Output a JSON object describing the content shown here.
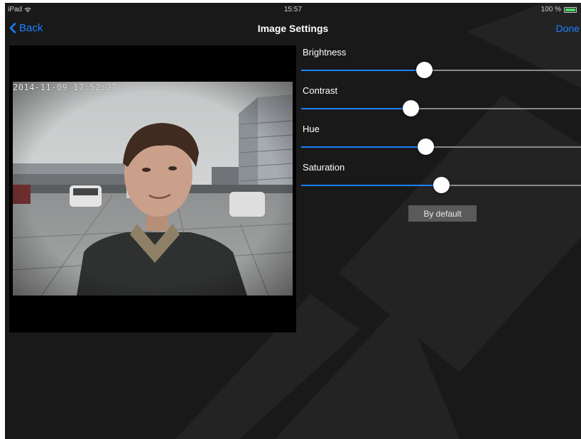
{
  "status_bar": {
    "device": "iPad",
    "wifi_icon": "wifi-icon",
    "time": "15:57",
    "battery_text": "100 %",
    "battery_level": 1.0,
    "battery_color": "#4cd964"
  },
  "nav": {
    "back_label": "Back",
    "title": "Image Settings",
    "done_label": "Done",
    "accent_color": "#1a82ff"
  },
  "video": {
    "timestamp": "2014-11-09  17:52:27"
  },
  "sliders": [
    {
      "label": "Brightness",
      "value": 0.44
    },
    {
      "label": "Contrast",
      "value": 0.39
    },
    {
      "label": "Hue",
      "value": 0.445
    },
    {
      "label": "Saturation",
      "value": 0.5
    }
  ],
  "default_button": {
    "label": "By default"
  }
}
